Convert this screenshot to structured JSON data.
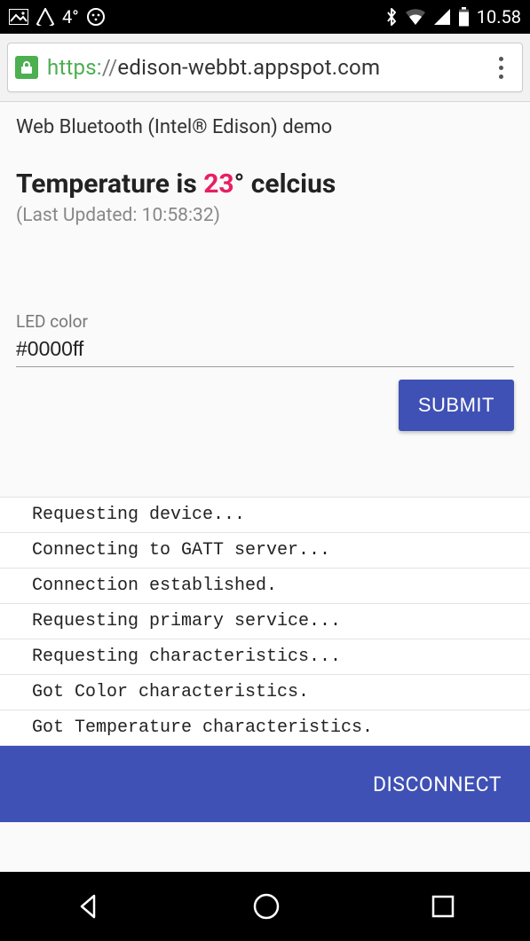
{
  "status": {
    "temp_out": "4°",
    "clock": "10.58"
  },
  "browser": {
    "scheme": "https:",
    "sep": "//",
    "host": "edison-webbt.appspot.com"
  },
  "page": {
    "demo_title": "Web Bluetooth (Intel® Edison) demo",
    "temp_prefix": "Temperature is ",
    "temp_value": "23",
    "temp_suffix": "° celcius",
    "updated_prefix": "(Last Updated: ",
    "updated_time": "10:58:32",
    "updated_suffix": ")"
  },
  "form": {
    "label": "LED color",
    "value": "#0000ff",
    "submit": "SUBMIT"
  },
  "log": [
    "Requesting device...",
    "Connecting to GATT server...",
    "Connection established.",
    "Requesting primary service...",
    "Requesting characteristics...",
    "Got Color characteristics.",
    "Got Temperature characteristics."
  ],
  "footer": {
    "disconnect": "DISCONNECT"
  }
}
